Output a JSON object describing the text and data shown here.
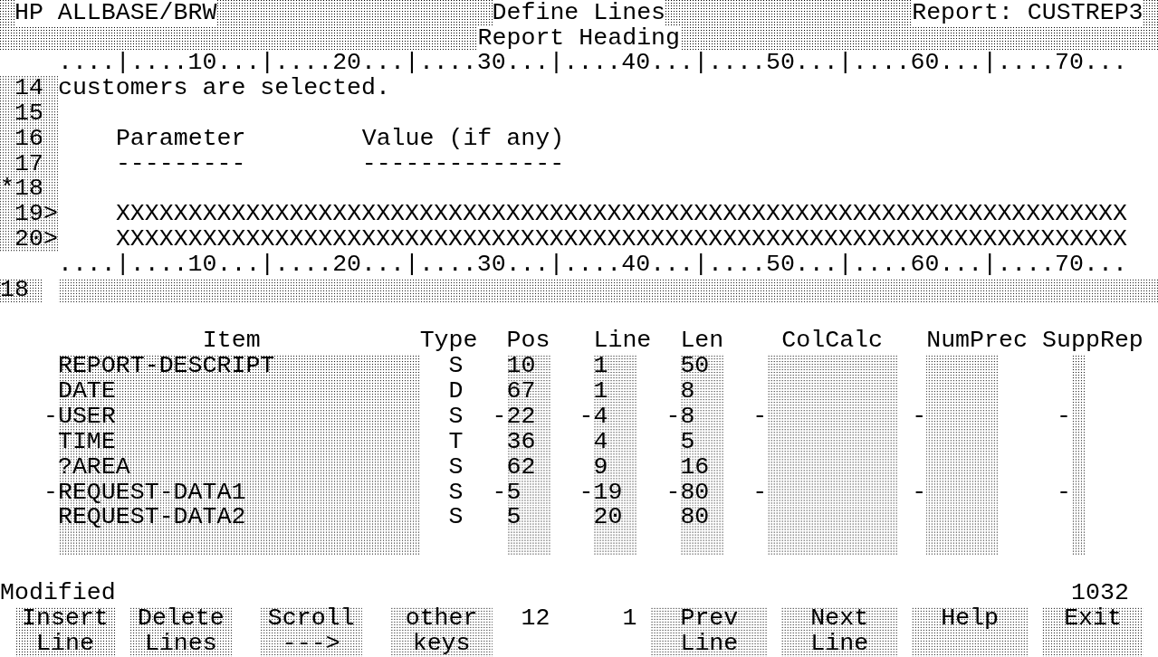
{
  "header": {
    "product": "HP ALLBASE/BRW",
    "title": "Define Lines",
    "report": "Report: CUSTREP3",
    "section": "Report Heading"
  },
  "editor": {
    "ruler_top": "....|....10...|....20...|....30...|....40...|....50...|....60...|....70...",
    "lines": [
      {
        "number": "14",
        "kind": "prose",
        "texts": [
          "customers are selected."
        ]
      },
      {
        "number": "15",
        "kind": "blank"
      },
      {
        "number": "16",
        "kind": "columns",
        "texts": [
          "Parameter",
          "Value (if any)"
        ]
      },
      {
        "number": "17",
        "kind": "columns",
        "texts": [
          "---------",
          "--------------"
        ]
      },
      {
        "number": "*18",
        "kind": "blank"
      },
      {
        "number": "19",
        "marker": ">",
        "kind": "mask",
        "texts": [
          "XXXXXXXXXXXXXXXXXXXXXXXXXXXXXXXXXXXXXXXXXXXXXXXXXXXXXXXXXXXXXXXXXXXXXX"
        ]
      },
      {
        "number": "20",
        "marker": ">",
        "kind": "mask",
        "texts": [
          "XXXXXXXXXXXXXXXXXXXXXXXXXXXXXXXXXXXXXXXXXXXXXXXXXXXXXXXXXXXXXXXXXXXXXX"
        ]
      }
    ],
    "ruler_bottom": "....|....10...|....20...|....30...|....40...|....50...|....60...|....70...",
    "edit_line": {
      "number": "18"
    }
  },
  "table": {
    "columns": [
      "Item",
      "Type",
      "Pos",
      "Line",
      "Len",
      "ColCalc",
      "NumPrec",
      "SuppRep"
    ],
    "rows": [
      {
        "cells": [
          {
            "text": "REPORT-DESCRIPT"
          },
          {
            "text": "S"
          },
          {
            "text": "10"
          },
          {
            "text": "1"
          },
          {
            "text": "50"
          }
        ]
      },
      {
        "cells": [
          {
            "text": "DATE"
          },
          {
            "text": "D"
          },
          {
            "text": "67"
          },
          {
            "text": "1"
          },
          {
            "text": "8"
          }
        ]
      },
      {
        "cells": [
          {
            "flag": "-",
            "text": "USER"
          },
          {
            "text": "S"
          },
          {
            "flag": "-",
            "text": "22"
          },
          {
            "flag": "-",
            "text": "4"
          },
          {
            "flag": "-",
            "text": "8"
          },
          {
            "flag": "-"
          },
          {
            "flag": "-"
          },
          {
            "flag": "-"
          }
        ]
      },
      {
        "cells": [
          {
            "text": "TIME"
          },
          {
            "text": "T"
          },
          {
            "text": "36"
          },
          {
            "text": "4"
          },
          {
            "text": "5"
          }
        ]
      },
      {
        "cells": [
          {
            "text": "?AREA"
          },
          {
            "text": "S"
          },
          {
            "text": "62"
          },
          {
            "text": "9"
          },
          {
            "text": "16"
          }
        ]
      },
      {
        "cells": [
          {
            "flag": "-",
            "text": "REQUEST-DATA1"
          },
          {
            "text": "S"
          },
          {
            "flag": "-",
            "text": "5"
          },
          {
            "flag": "-",
            "text": "19"
          },
          {
            "flag": "-",
            "text": "80"
          },
          {
            "flag": "-"
          },
          {
            "flag": "-"
          },
          {
            "flag": "-"
          }
        ]
      },
      {
        "cells": [
          {
            "text": "REQUEST-DATA2"
          },
          {
            "text": "S"
          },
          {
            "text": "5"
          },
          {
            "text": "20"
          },
          {
            "text": "80"
          }
        ]
      }
    ]
  },
  "status_bar": {
    "message": "Modified",
    "number": "1032"
  },
  "softkey_bar": {
    "keys": [
      {
        "lines": [
          "Insert",
          "Line"
        ]
      },
      {
        "lines": [
          "Delete",
          "Lines"
        ]
      },
      {
        "lines": [
          "Scroll",
          "--->"
        ]
      },
      {
        "lines": [
          "other",
          "keys"
        ]
      },
      {
        "lines": [
          "Prev",
          "Line"
        ]
      },
      {
        "lines": [
          "Next",
          "Line"
        ]
      },
      {
        "lines": [
          "Help"
        ]
      },
      {
        "lines": [
          "Exit"
        ]
      }
    ],
    "values": [
      "12",
      "1"
    ]
  }
}
